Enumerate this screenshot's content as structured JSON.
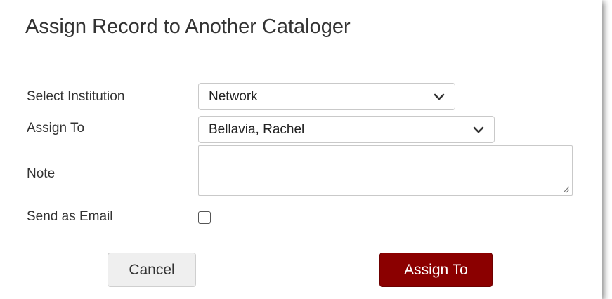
{
  "dialog": {
    "title": "Assign Record to Another Cataloger"
  },
  "form": {
    "institution_label": "Select Institution",
    "institution_value": "Network",
    "assign_to_label": "Assign To",
    "assign_to_value": "Bellavia, Rachel",
    "note_label": "Note",
    "note_value": "",
    "send_email_label": "Send as Email",
    "send_email_checked": false
  },
  "buttons": {
    "cancel_label": "Cancel",
    "assign_label": "Assign To"
  },
  "colors": {
    "primary_button": "#8b0000",
    "secondary_button": "#efefef",
    "border": "#c9c9c9",
    "text": "#333333"
  },
  "icons": {
    "select_chevron": "chevron-down-icon",
    "textarea_resize": "resize-handle-icon"
  }
}
